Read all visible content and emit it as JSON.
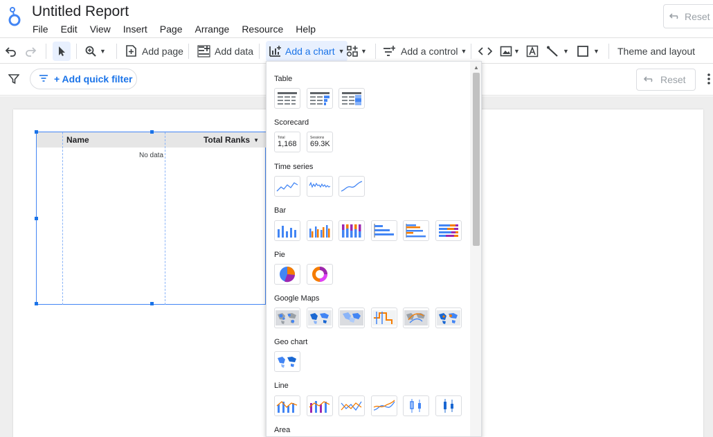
{
  "header": {
    "title": "Untitled Report",
    "reset_label": "Reset",
    "menu": [
      "File",
      "Edit",
      "View",
      "Insert",
      "Page",
      "Arrange",
      "Resource",
      "Help"
    ]
  },
  "toolbar": {
    "add_page": "Add page",
    "add_data": "Add data",
    "add_chart": "Add a chart",
    "add_control": "Add a control",
    "theme_layout": "Theme and layout"
  },
  "filterbar": {
    "quick_filter": "+ Add quick filter",
    "reset_label": "Reset"
  },
  "table": {
    "columns": [
      "Name",
      "Total Ranks"
    ],
    "empty_text": "No data"
  },
  "chart_menu": {
    "sections": [
      "Table",
      "Scorecard",
      "Time series",
      "Bar",
      "Pie",
      "Google Maps",
      "Geo chart",
      "Line",
      "Area"
    ],
    "scorecards": [
      {
        "label": "Total",
        "value": "1,168"
      },
      {
        "label": "Sessions",
        "value": "69.3K"
      }
    ]
  },
  "colors": {
    "accent": "#1a73e8",
    "chart_blue": "#4285f4",
    "chart_orange": "#f57c00",
    "chart_purple": "#9c27b0"
  }
}
